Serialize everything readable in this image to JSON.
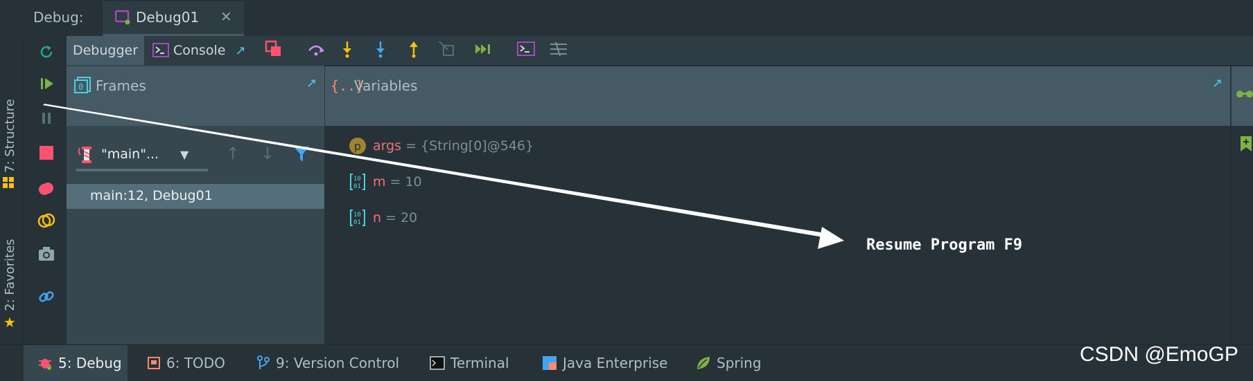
{
  "header": {
    "label": "Debug:",
    "tab": "Debug01"
  },
  "left_strip": {
    "structure": "7: Structure",
    "favorites": "2: Favorites"
  },
  "toolbar": {
    "debugger_tab": "Debugger",
    "console_tab": "Console"
  },
  "frames": {
    "title": "Frames",
    "thread": "\"main\"...",
    "items": [
      "main:12, Debug01"
    ]
  },
  "variables": {
    "title": "Variables",
    "items": [
      {
        "badge": "p",
        "name": "args",
        "eq": "=",
        "value": "{String[0]@546}"
      },
      {
        "badge": "10\n01",
        "name": "m",
        "eq": "=",
        "value": "10"
      },
      {
        "badge": "10\n01",
        "name": "n",
        "eq": "=",
        "value": "20"
      }
    ]
  },
  "annotation": {
    "text": "Resume Program F9"
  },
  "bottom_bar": {
    "debug": "5: Debug",
    "todo": "6: TODO",
    "vcs": "9: Version Control",
    "terminal": "Terminal",
    "java_ee": "Java Enterprise",
    "spring": "Spring"
  },
  "watermark": "CSDN @EmoGP",
  "colors": {
    "background": "#263238",
    "panel": "#37474F",
    "header": "#455A64",
    "selected_row": "#546E7A",
    "var_name": "#f07178",
    "accent_green": "#7CB342",
    "stop_red": "#ff5370"
  }
}
